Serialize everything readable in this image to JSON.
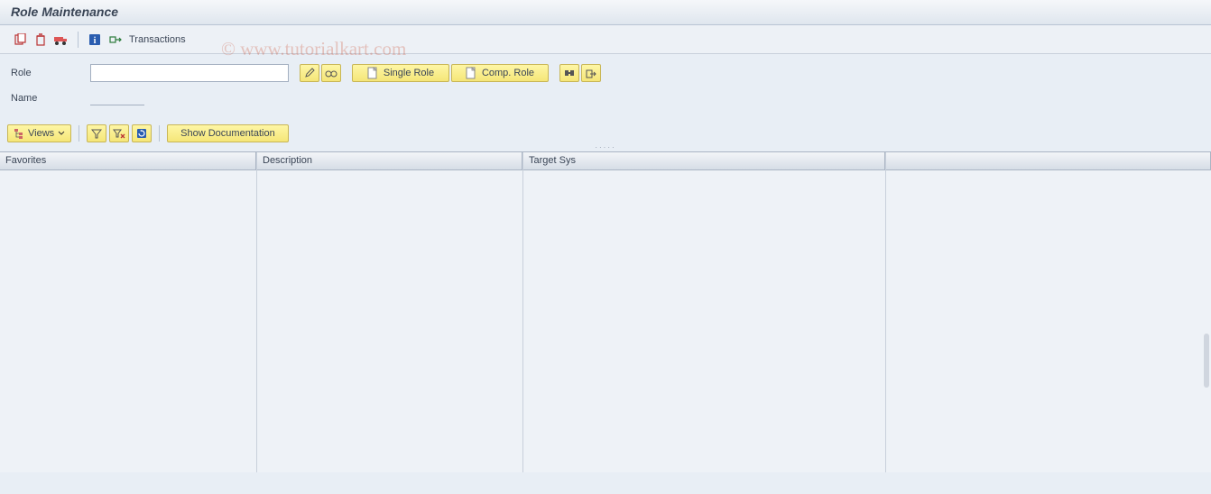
{
  "title": "Role Maintenance",
  "toolbar": {
    "transactions_label": "Transactions"
  },
  "form": {
    "role_label": "Role",
    "role_value": "",
    "name_label": "Name",
    "name_value": "",
    "single_role_label": "Single Role",
    "comp_role_label": "Comp. Role"
  },
  "midbar": {
    "views_label": "Views",
    "show_doc_label": "Show Documentation"
  },
  "grid": {
    "col_favorites": "Favorites",
    "col_description": "Description",
    "col_targetsys": "Target Sys",
    "rows": []
  },
  "watermark": "© www.tutorialkart.com"
}
